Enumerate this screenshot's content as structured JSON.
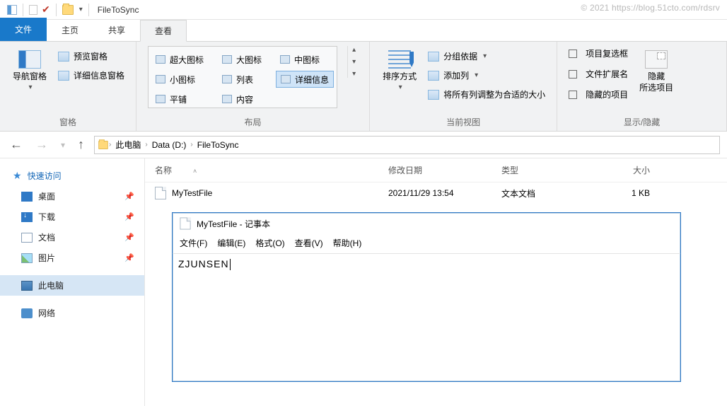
{
  "watermark": "© 2021 https://blog.51cto.com/rdsrv",
  "window": {
    "title": "FileToSync"
  },
  "tabs": {
    "file": "文件",
    "home": "主页",
    "share": "共享",
    "view": "查看"
  },
  "ribbon": {
    "panes": {
      "nav": "导航窗格",
      "preview": "预览窗格",
      "details": "详细信息窗格",
      "group_label": "窗格"
    },
    "layout": {
      "xl": "超大图标",
      "lg": "大图标",
      "md": "中图标",
      "sm": "小图标",
      "list": "列表",
      "details": "详细信息",
      "tiles": "平铺",
      "content": "内容",
      "group_label": "布局"
    },
    "view": {
      "sort": "排序方式",
      "groupby": "分组依据",
      "addcol": "添加列",
      "autosize": "将所有列调整为合适的大小",
      "group_label": "当前视图"
    },
    "show": {
      "checkboxes": "项目复选框",
      "extensions": "文件扩展名",
      "hidden": "隐藏的项目",
      "hide_btn": "隐藏",
      "hide_sub": "所选项目",
      "group_label": "显示/隐藏"
    }
  },
  "breadcrumb": {
    "root": "此电脑",
    "drive": "Data (D:)",
    "folder": "FileToSync"
  },
  "sidebar": {
    "quick": "快速访问",
    "desktop": "桌面",
    "downloads": "下载",
    "documents": "文档",
    "pictures": "图片",
    "thispc": "此电脑",
    "network": "网络"
  },
  "columns": {
    "name": "名称",
    "date": "修改日期",
    "type": "类型",
    "size": "大小"
  },
  "files": [
    {
      "name": "MyTestFile",
      "date": "2021/11/29 13:54",
      "type": "文本文档",
      "size": "1 KB"
    }
  ],
  "notepad": {
    "title": "MyTestFile - 记事本",
    "menu": {
      "file": "文件(F)",
      "edit": "编辑(E)",
      "format": "格式(O)",
      "view": "查看(V)",
      "help": "帮助(H)"
    },
    "content": "ZJUNSEN"
  }
}
